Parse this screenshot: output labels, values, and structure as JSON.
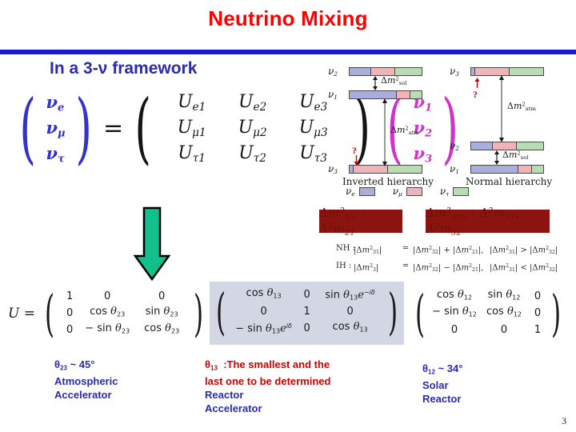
{
  "slide": {
    "title": "Neutrino Mixing",
    "subheading": "In a 3-ν framework",
    "page_number": "3",
    "accent_rule_color": "#1a1ad0",
    "title_color": "#ff0000",
    "heading_color": "#2b2bb0"
  },
  "pmns_equation": {
    "flavor_states": [
      "ν",
      "ν",
      "ν"
    ],
    "flavor_subscripts": [
      "e",
      "μ",
      "τ"
    ],
    "flavor_color": "#3333cc",
    "equals": "=",
    "matrix_symbol": "U",
    "matrix_rows": [
      [
        "U",
        "U",
        "U"
      ],
      [
        "U",
        "U",
        "U"
      ],
      [
        "U",
        "U",
        "U"
      ]
    ],
    "matrix_subscripts": [
      [
        "e1",
        "e2",
        "e3"
      ],
      [
        "μ1",
        "μ2",
        "μ3"
      ],
      [
        "τ1",
        "τ2",
        "τ3"
      ]
    ],
    "mass_states": [
      "ν",
      "ν",
      "ν"
    ],
    "mass_subscripts": [
      "1",
      "2",
      "3"
    ],
    "mass_color": "#cc33cc"
  },
  "green_arrow": {
    "direction": "down",
    "fill": "#12c08e",
    "stroke": "#000000"
  },
  "hierarchy_figure": {
    "inverted_label": "Inverted hierarchy",
    "normal_label": "Normal hierarchy",
    "solar_splitting_label": "Δm",
    "solar_splitting_sup": "2",
    "solar_splitting_sub": "sol",
    "atm_splitting_label": "Δm",
    "atm_splitting_sup": "2",
    "atm_splitting_sub": "atm",
    "question_mark": "?",
    "question_color": "#d00000",
    "inverted": {
      "levels": [
        {
          "name": "ν",
          "sub": "2",
          "composition": [
            30,
            32,
            30
          ]
        },
        {
          "name": "ν",
          "sub": "1",
          "composition": [
            66,
            17,
            14
          ]
        },
        {
          "name": "ν",
          "sub": "3",
          "composition": [
            4,
            48,
            46
          ]
        }
      ]
    },
    "normal": {
      "levels": [
        {
          "name": "ν",
          "sub": "3",
          "composition": [
            4,
            48,
            46
          ]
        },
        {
          "name": "ν",
          "sub": "2",
          "composition": [
            30,
            32,
            30
          ]
        },
        {
          "name": "ν",
          "sub": "1",
          "composition": [
            66,
            17,
            14
          ]
        }
      ]
    },
    "legend": [
      {
        "name": "ν",
        "sub": "e",
        "color": "#a9aedd"
      },
      {
        "name": "ν",
        "sub": "μ",
        "color": "#f0b4b8"
      },
      {
        "name": "ν",
        "sub": "τ",
        "color": "#b8ddb3"
      }
    ]
  },
  "formula_boxes": {
    "background": "#8c1410",
    "text_color": "#6e0f0c",
    "solar": "Δm²sol : Δ²m21",
    "atmospheric": "Δm²atm : Δ²m31, Δ²m32"
  },
  "relations": [
    {
      "tag": "NH :",
      "lhs": "|Δm²31|",
      "eq": "=",
      "rhs": "|Δm²32| + |Δm²21|,",
      "inequality": "|Δm²31| > |Δm²32|"
    },
    {
      "tag": "IH :",
      "lhs": "|Δm²3|",
      "eq": "=",
      "rhs": "|Δm²32| − |Δm²21|,",
      "inequality": "|Δm²31| < |Δm²32|"
    }
  ],
  "u_factorization": {
    "lhs": "U =",
    "matrix_23": [
      [
        "1",
        "0",
        "0"
      ],
      [
        "0",
        "cos θ23",
        "sin θ23"
      ],
      [
        "0",
        "− sin θ23",
        "cos θ23"
      ]
    ],
    "matrix_13": [
      [
        "cos θ13",
        "0",
        "sin θ13e−iδ"
      ],
      [
        "0",
        "1",
        "0"
      ],
      [
        "− sin θ13eiδ",
        "0",
        "cos θ13"
      ]
    ],
    "matrix_12": [
      [
        "cos θ12",
        "sin θ12",
        "0"
      ],
      [
        "− sin θ12",
        "cos θ12",
        "0"
      ],
      [
        "0",
        "0",
        "1"
      ]
    ],
    "highlight_color": "#d3d7e3"
  },
  "annotations": {
    "theta23": {
      "value_line": "θ23 ~ 45°",
      "sources": [
        "Atmospheric",
        "Accelerator"
      ],
      "color": "#2b2bb0"
    },
    "theta13": {
      "headline_1": "θ13  :The smallest and the",
      "headline_2": "last one to be determined",
      "sources": [
        "Reactor",
        "Accelerator"
      ],
      "headline_color": "#d00000",
      "source_color": "#2b2bb0"
    },
    "theta12": {
      "value_line": "θ12 ~ 34°",
      "sources": [
        "Solar",
        "Reactor"
      ],
      "color": "#2b2bb0"
    }
  }
}
